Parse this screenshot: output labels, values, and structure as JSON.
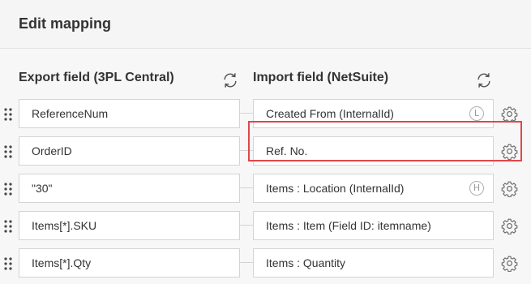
{
  "header": {
    "title": "Edit mapping"
  },
  "columns": {
    "export_label": "Export field (3PL Central)",
    "import_label": "Import field (NetSuite)"
  },
  "rows": [
    {
      "export": "ReferenceNum",
      "import": "Created From (InternalId)",
      "badge": "L"
    },
    {
      "export": "OrderID",
      "import": "Ref. No.",
      "badge": ""
    },
    {
      "export": "\"30\"",
      "import": "Items : Location (InternalId)",
      "badge": "H"
    },
    {
      "export": "Items[*].SKU",
      "import": "Items : Item (Field ID: itemname)",
      "badge": ""
    },
    {
      "export": "Items[*].Qty",
      "import": "Items : Quantity",
      "badge": ""
    }
  ],
  "icons": {
    "refresh": "refresh-icon",
    "settings": "gear-icon",
    "drag": "drag-handle-icon"
  },
  "colors": {
    "highlight": "#e2464a",
    "header_bg": "#f5f5f5",
    "field_border": "#d4d4d4"
  }
}
